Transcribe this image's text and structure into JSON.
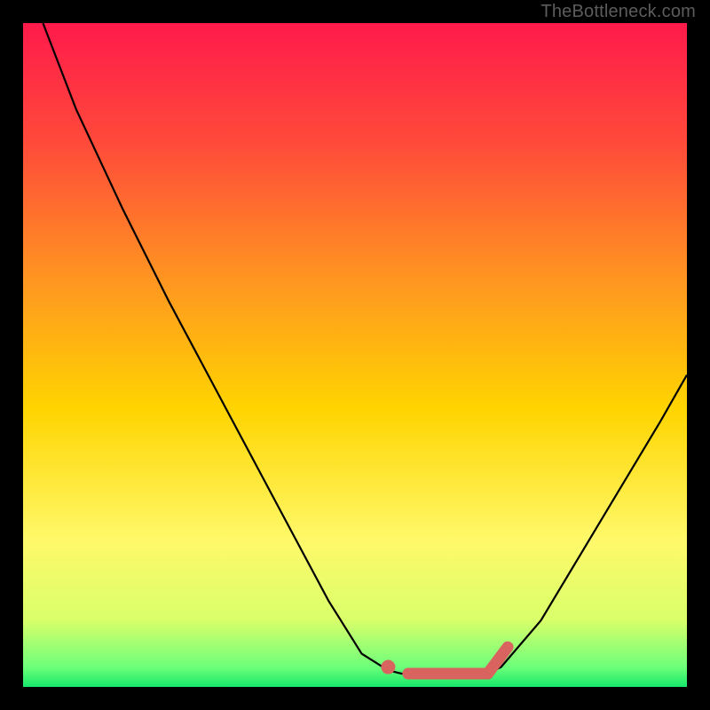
{
  "watermark": "TheBottleneck.com",
  "colors": {
    "gradient_top": "#ff1a4b",
    "gradient_mid1": "#ff7a2a",
    "gradient_mid2": "#ffd400",
    "gradient_mid3": "#fff96a",
    "gradient_bottom": "#17e86b",
    "curve": "#000000",
    "marker": "#d9645f",
    "frame_bg": "#000000"
  },
  "chart_data": {
    "type": "line",
    "title": "",
    "xlabel": "",
    "ylabel": "",
    "xlim": [
      0,
      100
    ],
    "ylim": [
      0,
      100
    ],
    "x": [
      3,
      8,
      15,
      22,
      30,
      38,
      46,
      51,
      55,
      57,
      58,
      62,
      66,
      70,
      72,
      78,
      84,
      90,
      96,
      100
    ],
    "values": [
      100,
      87,
      72,
      58,
      43,
      28,
      13,
      5,
      2.5,
      2,
      2,
      2,
      2,
      2,
      3,
      10,
      20,
      30,
      40,
      47
    ],
    "annotations": [
      {
        "kind": "marker_dot",
        "x": 55,
        "y": 3
      },
      {
        "kind": "thick_segment",
        "x_from": 58,
        "x_to": 70,
        "y": 2
      },
      {
        "kind": "thick_segment_diag",
        "x_from": 70,
        "y_from": 2,
        "x_to": 73,
        "y_to": 6
      }
    ]
  }
}
